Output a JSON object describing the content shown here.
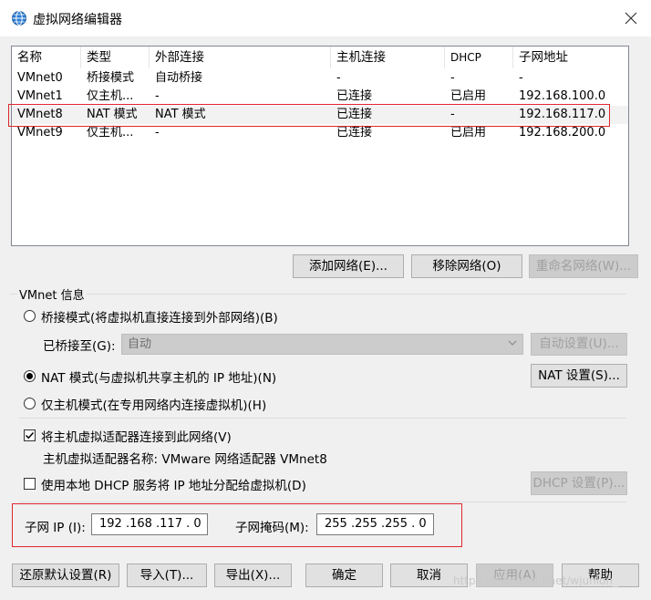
{
  "window": {
    "title": "虚拟网络编辑器"
  },
  "table": {
    "headers": [
      "名称",
      "类型",
      "外部连接",
      "主机连接",
      "DHCP",
      "子网地址"
    ],
    "rows": [
      [
        "VMnet0",
        "桥接模式",
        "自动桥接",
        "-",
        "-",
        "-"
      ],
      [
        "VMnet1",
        "仅主机...",
        "-",
        "已连接",
        "已启用",
        "192.168.100.0"
      ],
      [
        "VMnet8",
        "NAT 模式",
        "NAT 模式",
        "已连接",
        "-",
        "192.168.117.0"
      ],
      [
        "VMnet9",
        "仅主机...",
        "-",
        "已连接",
        "已启用",
        "192.168.200.0"
      ]
    ],
    "selected_row": "VMnet8"
  },
  "network_buttons": {
    "add": "添加网络(E)...",
    "remove": "移除网络(O)",
    "rename": "重命名网络(W)..."
  },
  "vmnet_info": {
    "group_label": "VMnet 信息",
    "bridged_label": "桥接模式(将虚拟机直接连接到外部网络)(B)",
    "bridged_to_label": "已桥接至(G):",
    "bridged_to_value": "自动",
    "auto_settings": "自动设置(U)...",
    "nat_label": "NAT 模式(与虚拟机共享主机的 IP 地址)(N)",
    "nat_settings": "NAT 设置(S)...",
    "hostonly_label": "仅主机模式(在专用网络内连接虚拟机)(H)",
    "selected_mode": "NAT",
    "connect_adapter_label": "将主机虚拟适配器连接到此网络(V)",
    "connect_adapter_checked": true,
    "adapter_name_text": "主机虚拟适配器名称: VMware 网络适配器 VMnet8",
    "dhcp_label": "使用本地 DHCP 服务将 IP 地址分配给虚拟机(D)",
    "dhcp_checked": false,
    "dhcp_settings": "DHCP 设置(P)...",
    "subnet_ip_label": "子网 IP (I):",
    "subnet_ip_value": "192 .168 .117 . 0",
    "subnet_mask_label": "子网掩码(M):",
    "subnet_mask_value": "255 .255 .255 . 0"
  },
  "footer_buttons": {
    "restore": "还原默认设置(R)",
    "import": "导入(T)...",
    "export": "导出(X)...",
    "ok": "确定",
    "cancel": "取消",
    "apply": "应用(A)",
    "help": "帮助"
  },
  "watermark": "https://blog.csdn.net/wjunion_",
  "colors": {
    "highlight_border": "#e0262f",
    "window_bg": "#f0f0f0"
  }
}
